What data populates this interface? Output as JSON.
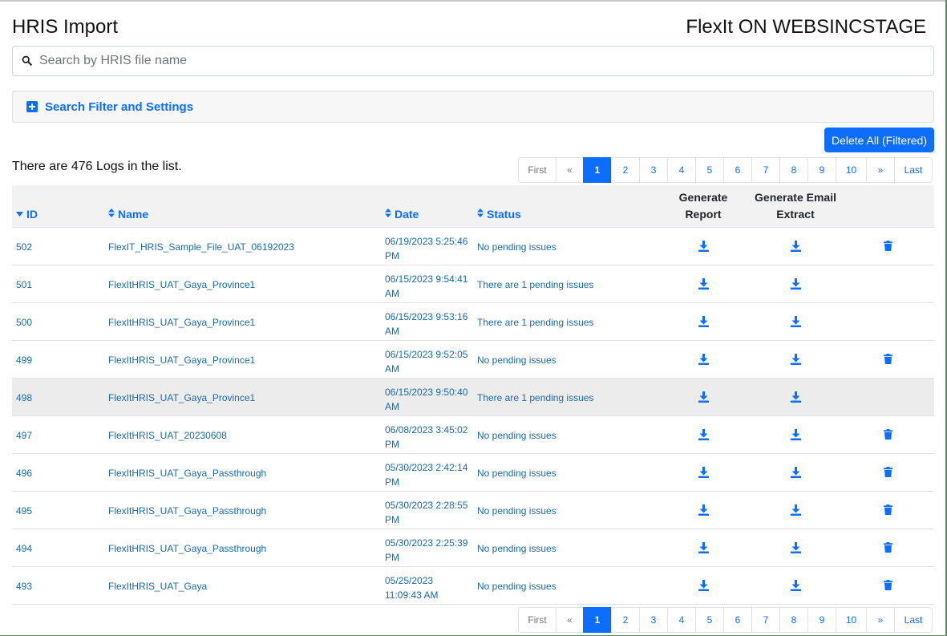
{
  "page": {
    "title": "HRIS Import",
    "environment": "FlexIt ON WEBSINCSTAGE"
  },
  "search": {
    "placeholder": "Search by HRIS file name",
    "value": ""
  },
  "filter_panel": {
    "label": "Search Filter and Settings"
  },
  "actions": {
    "delete_all_label": "Delete All (Filtered)"
  },
  "summary": {
    "count_text": "There are 476 Logs in the list."
  },
  "pagination": {
    "first": "First",
    "prev": "«",
    "pages": [
      "1",
      "2",
      "3",
      "4",
      "5",
      "6",
      "7",
      "8",
      "9",
      "10"
    ],
    "active_page": "1",
    "next": "»",
    "last": "Last"
  },
  "table": {
    "columns": {
      "id": "ID",
      "name": "Name",
      "date": "Date",
      "status": "Status",
      "generate_report_line1": "Generate",
      "generate_report_line2": "Report",
      "generate_email_line1": "Generate Email",
      "generate_email_line2": "Extract"
    },
    "sort": {
      "column": "ID",
      "direction": "descending"
    },
    "rows": [
      {
        "id": "502",
        "name": "FlexIT_HRIS_Sample_File_UAT_06192023",
        "date_line1": "06/19/2023 5:25:46",
        "date_line2": "PM",
        "status": "No pending issues",
        "deletable": true
      },
      {
        "id": "501",
        "name": "FlexItHRIS_UAT_Gaya_Province1",
        "date_line1": "06/15/2023 9:54:41",
        "date_line2": "AM",
        "status": "There are 1 pending issues",
        "deletable": false
      },
      {
        "id": "500",
        "name": "FlexItHRIS_UAT_Gaya_Province1",
        "date_line1": "06/15/2023 9:53:16",
        "date_line2": "AM",
        "status": "There are 1 pending issues",
        "deletable": false
      },
      {
        "id": "499",
        "name": "FlexItHRIS_UAT_Gaya_Province1",
        "date_line1": "06/15/2023 9:52:05",
        "date_line2": "AM",
        "status": "No pending issues",
        "deletable": true
      },
      {
        "id": "498",
        "name": "FlexItHRIS_UAT_Gaya_Province1",
        "date_line1": "06/15/2023 9:50:40",
        "date_line2": "AM",
        "status": "There are 1 pending issues",
        "deletable": false,
        "highlighted": true
      },
      {
        "id": "497",
        "name": "FlexItHRIS_UAT_20230608",
        "date_line1": "06/08/2023 3:45:02",
        "date_line2": "PM",
        "status": "No pending issues",
        "deletable": true
      },
      {
        "id": "496",
        "name": "FlexItHRIS_UAT_Gaya_Passthrough",
        "date_line1": "05/30/2023 2:42:14",
        "date_line2": "PM",
        "status": "No pending issues",
        "deletable": true
      },
      {
        "id": "495",
        "name": "FlexItHRIS_UAT_Gaya_Passthrough",
        "date_line1": "05/30/2023 2:28:55",
        "date_line2": "PM",
        "status": "No pending issues",
        "deletable": true
      },
      {
        "id": "494",
        "name": "FlexItHRIS_UAT_Gaya_Passthrough",
        "date_line1": "05/30/2023 2:25:39",
        "date_line2": "PM",
        "status": "No pending issues",
        "deletable": true
      },
      {
        "id": "493",
        "name": "FlexItHRIS_UAT_Gaya",
        "date_line1": "05/25/2023",
        "date_line2": "11:09:43 AM",
        "status": "No pending issues",
        "deletable": true
      }
    ]
  },
  "icons": {
    "search": "search-icon",
    "expand": "plus-square-icon",
    "sort_desc": "sort-desc-icon",
    "sort": "sort-icon",
    "download": "download-icon",
    "delete": "trash-icon"
  },
  "colors": {
    "accent": "#0d6efd",
    "link": "#1a6aa8",
    "header_bg": "#f2f2f2",
    "highlight_row": "#ececec"
  }
}
